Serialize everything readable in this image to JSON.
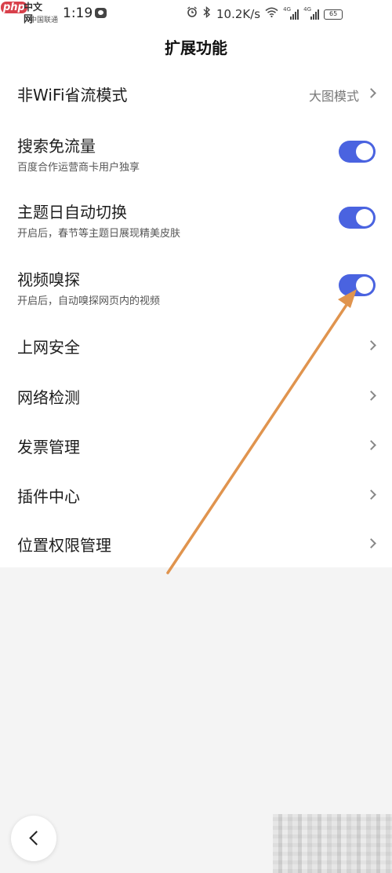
{
  "status_bar": {
    "watermark_logo": "php",
    "watermark_site": "中文网",
    "carrier": "中国联通",
    "time": "1:19",
    "speed": "10.2K/s",
    "signal1_tag": "4G",
    "signal2_tag": "4G",
    "battery": "65",
    "icons": [
      "app-icon",
      "alarm-icon",
      "bluetooth-icon",
      "wifi-icon",
      "signal-icon",
      "battery-icon"
    ]
  },
  "header": {
    "title": "扩展功能"
  },
  "settings": {
    "non_wifi": {
      "title": "非WiFi省流模式",
      "value": "大图模式"
    },
    "search_free": {
      "title": "搜索免流量",
      "subtitle": "百度合作运营商卡用户独享",
      "enabled": true
    },
    "theme_day": {
      "title": "主题日自动切换",
      "subtitle": "开启后，春节等主题日展现精美皮肤",
      "enabled": true
    },
    "video_sniff": {
      "title": "视频嗅探",
      "subtitle": "开启后，自动嗅探网页内的视频",
      "enabled": true
    },
    "web_security": {
      "title": "上网安全"
    },
    "network_check": {
      "title": "网络检测"
    },
    "invoice": {
      "title": "发票管理"
    },
    "plugins": {
      "title": "插件中心"
    },
    "permissions": {
      "title": "位置权限管理"
    }
  },
  "colors": {
    "toggle_on": "#4a63e0",
    "annotation_arrow": "#e0944e",
    "page_background": "#f4f4f4"
  }
}
